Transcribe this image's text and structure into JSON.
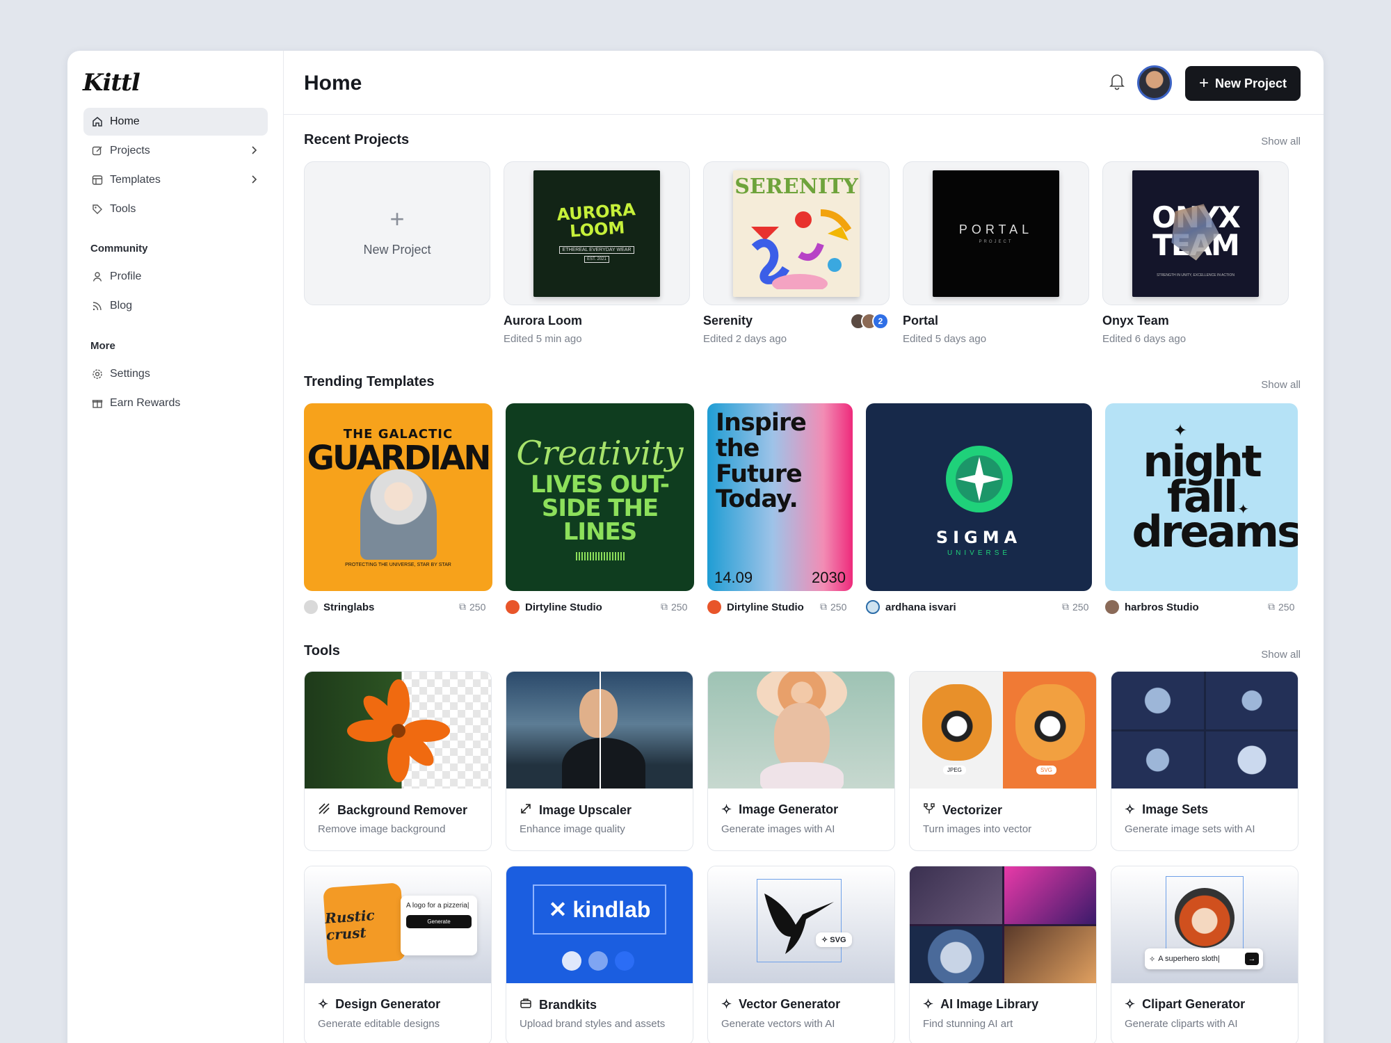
{
  "brand": {
    "logo": "Kittl"
  },
  "sidebar": {
    "items": [
      {
        "label": "Home",
        "icon": "home-icon",
        "active": true
      },
      {
        "label": "Projects",
        "icon": "edit-icon",
        "chevron": true
      },
      {
        "label": "Templates",
        "icon": "layout-icon",
        "chevron": true
      },
      {
        "label": "Tools",
        "icon": "tag-icon"
      }
    ],
    "community": {
      "heading": "Community",
      "items": [
        {
          "label": "Profile",
          "icon": "user-icon"
        },
        {
          "label": "Blog",
          "icon": "rss-icon"
        }
      ]
    },
    "more": {
      "heading": "More",
      "items": [
        {
          "label": "Settings",
          "icon": "gear-icon"
        },
        {
          "label": "Earn Rewards",
          "icon": "gift-icon"
        }
      ]
    }
  },
  "header": {
    "title": "Home",
    "new_project_label": "New Project"
  },
  "recent": {
    "heading": "Recent Projects",
    "show_all": "Show all",
    "new_card_label": "New Project",
    "projects": [
      {
        "name": "Aurora Loom",
        "edited": "Edited 5 min ago",
        "art_title": "AURORA LOOM",
        "art_sub": "ETHEREAL EVERYDAY WEAR",
        "art_est": "EST. 2021"
      },
      {
        "name": "Serenity",
        "edited": "Edited 2 days ago",
        "art_title": "SERENITY",
        "collaborators_extra": "2"
      },
      {
        "name": "Portal",
        "edited": "Edited 5 days ago",
        "art_title": "PORTAL",
        "art_sub": "PROJECT"
      },
      {
        "name": "Onyx Team",
        "edited": "Edited 6 days ago",
        "art_title": "ONYX TEAM",
        "art_sub": "STRENGTH IN UNITY, EXCELLENCE IN ACTION"
      }
    ]
  },
  "trending": {
    "heading": "Trending Templates",
    "show_all": "Show all",
    "templates": [
      {
        "author": "Stringlabs",
        "count": "250",
        "art_title": "THE GALACTIC",
        "art_big": "GUARDIAN",
        "art_foot": "PROTECTING THE UNIVERSE, STAR BY STAR"
      },
      {
        "author": "Dirtyline Studio",
        "count": "250",
        "art_script": "Creativity",
        "art_big": "LIVES OUT-SIDE THE LINES"
      },
      {
        "author": "Dirtyline Studio",
        "count": "250",
        "art_big": "Inspire the Future Today.",
        "art_date": "14.09",
        "art_year": "2030"
      },
      {
        "author": "ardhana isvari",
        "count": "250",
        "art_big": "SIGMA",
        "art_sub": "UNIVERSE"
      },
      {
        "author": "harbros Studio",
        "count": "250",
        "art_big": "night fall dreams"
      }
    ]
  },
  "tools": {
    "heading": "Tools",
    "show_all": "Show all",
    "items": [
      {
        "name": "Background Remover",
        "desc": "Remove image background",
        "icon": "eraser-icon"
      },
      {
        "name": "Image Upscaler",
        "desc": "Enhance image quality",
        "icon": "expand-icon"
      },
      {
        "name": "Image Generator",
        "desc": "Generate images with AI",
        "icon": "sparkle-icon"
      },
      {
        "name": "Vectorizer",
        "desc": "Turn images into vector",
        "icon": "vector-icon",
        "tag_a": "JPEG",
        "tag_b": "SVG"
      },
      {
        "name": "Image Sets",
        "desc": "Generate image sets with AI",
        "icon": "sparkle-icon"
      },
      {
        "name": "Design Generator",
        "desc": "Generate editable designs",
        "icon": "sparkle-icon",
        "prompt": "A logo for a pizzeria|",
        "button": "Generate",
        "art": "Rustic crust"
      },
      {
        "name": "Brandkits",
        "desc": "Upload brand styles and assets",
        "icon": "briefcase-icon",
        "art": "kindlab"
      },
      {
        "name": "Vector Generator",
        "desc": "Generate vectors with AI",
        "icon": "sparkle-icon",
        "tag": "SVG"
      },
      {
        "name": "AI Image Library",
        "desc": "Find stunning AI art",
        "icon": "sparkle-icon"
      },
      {
        "name": "Clipart Generator",
        "desc": "Generate cliparts with AI",
        "icon": "sparkle-icon",
        "prompt": "A superhero sloth|"
      }
    ]
  },
  "colors": {
    "accent": "#15171c",
    "orange": "#f7a21b",
    "green_dark": "#0f3d1f",
    "navy": "#17294a",
    "sky": "#b5e2f6",
    "blue": "#1b5ee0"
  }
}
